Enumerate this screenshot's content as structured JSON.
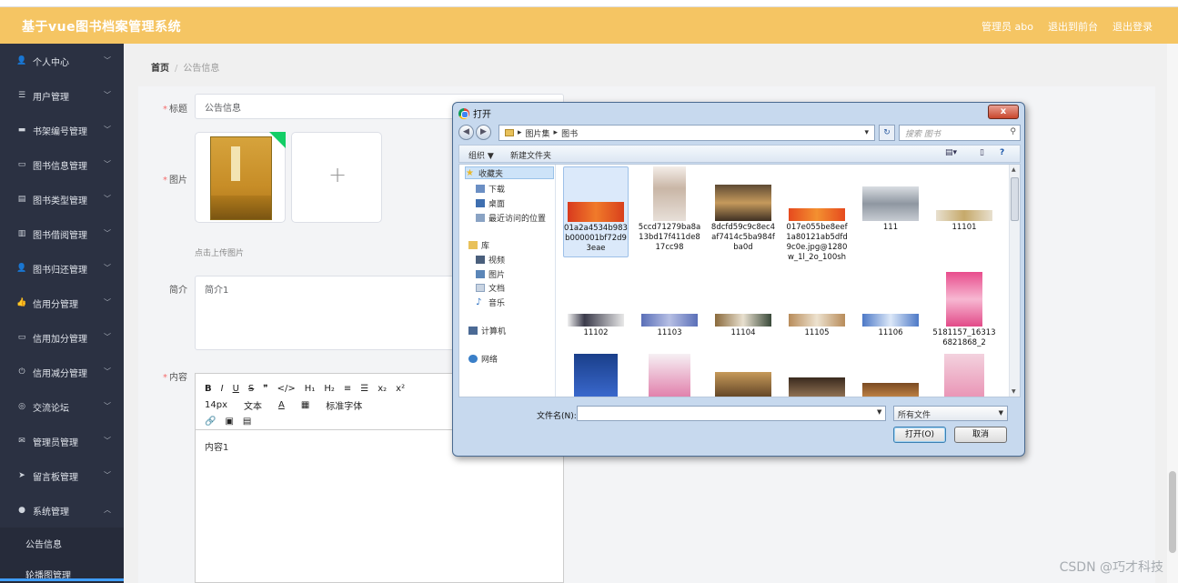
{
  "header": {
    "title": "基于vue图书档案管理系统",
    "links": [
      "管理员 abo",
      "退出到前台",
      "退出登录"
    ]
  },
  "sidebar": {
    "items": [
      {
        "label": "个人中心",
        "icon": "user-icon"
      },
      {
        "label": "用户管理",
        "icon": "list-icon"
      },
      {
        "label": "书架编号管理",
        "icon": "card-icon"
      },
      {
        "label": "图书信息管理",
        "icon": "monitor-icon"
      },
      {
        "label": "图书类型管理",
        "icon": "document-icon"
      },
      {
        "label": "图书借阅管理",
        "icon": "chart-icon"
      },
      {
        "label": "图书归还管理",
        "icon": "user-icon"
      },
      {
        "label": "信用分管理",
        "icon": "thumb-icon"
      },
      {
        "label": "信用加分管理",
        "icon": "monitor-icon"
      },
      {
        "label": "信用减分管理",
        "icon": "power-icon"
      },
      {
        "label": "交流论坛",
        "icon": "globe-icon"
      },
      {
        "label": "管理员管理",
        "icon": "mail-icon"
      },
      {
        "label": "留言板管理",
        "icon": "send-icon"
      },
      {
        "label": "系统管理",
        "icon": "pin-icon"
      }
    ],
    "subitems": [
      "公告信息",
      "轮播图管理"
    ]
  },
  "breadcrumb": {
    "home": "首页",
    "current": "公告信息"
  },
  "form": {
    "title_label": "标题",
    "title_value": "公告信息",
    "image_label": "图片",
    "upload_hint": "点击上传图片",
    "intro_label": "简介",
    "intro_value": "简介1",
    "content_label": "内容",
    "content_value": "内容1",
    "toolbar_row1": [
      "B",
      "I",
      "U",
      "S",
      "❞",
      "</>",
      "H₁",
      "H₂",
      "≡",
      "☰",
      "x₂",
      "x²"
    ],
    "toolbar_row2": [
      "14px",
      "文本",
      "A",
      "▦",
      "标准字体"
    ],
    "toolbar_row3": [
      "🔗",
      "▣",
      "▤"
    ]
  },
  "dialog": {
    "title": "打开",
    "close": "x",
    "path": [
      "图片集",
      "图书"
    ],
    "search_placeholder": "搜索 图书",
    "organize": "组织 ▼",
    "new_folder": "新建文件夹",
    "nav": {
      "favorites": "收藏夹",
      "fav_items": [
        "下载",
        "桌面",
        "最近访问的位置"
      ],
      "library": "库",
      "lib_items": [
        "视频",
        "图片",
        "文档",
        "音乐"
      ],
      "computer": "计算机",
      "network": "网络"
    },
    "files": [
      "01a2a4534b983b000001bf72d93eae",
      "5ccd71279ba8a13bd17f411de817cc98",
      "8dcfd59c9c8ec4af7414c5ba984fba0d",
      "017e055be8eef1a80121ab5dfd9c0e.jpg@1280w_1l_2o_100sh",
      "111",
      "11101",
      "11102",
      "11103",
      "11104",
      "11105",
      "11106",
      "5181157_163136821868_2"
    ],
    "filename_label": "文件名(N):",
    "filename_value": "",
    "filetype": "所有文件",
    "open_button": "打开(O)",
    "cancel_button": "取消"
  },
  "watermark": "CSDN @巧才科技"
}
